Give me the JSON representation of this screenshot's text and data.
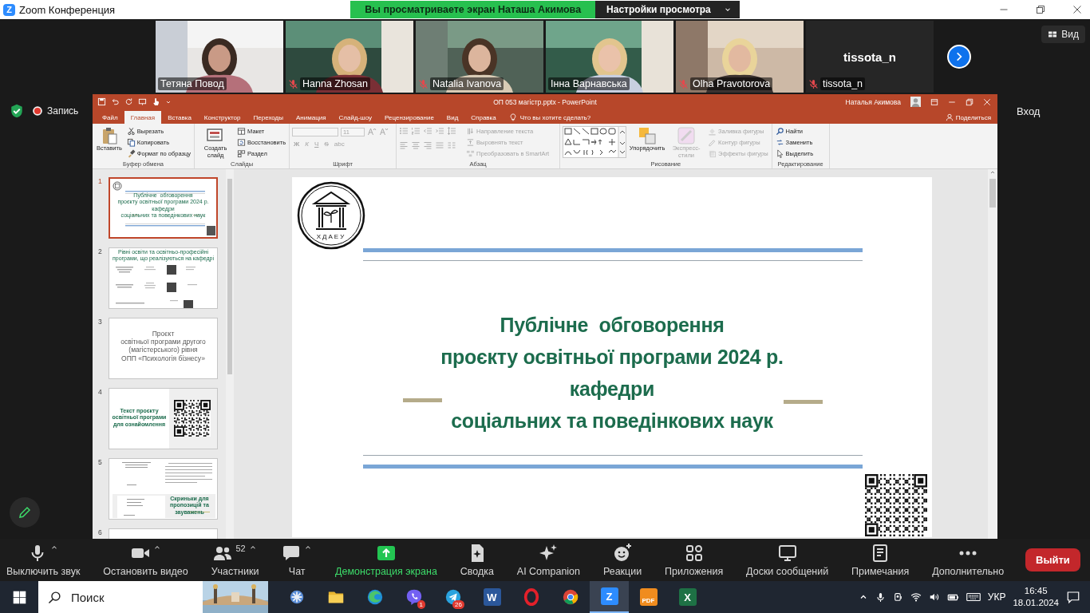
{
  "window": {
    "logo": "Z",
    "title": "Zoom Конференция"
  },
  "share_banner": {
    "text": "Вы просматриваете экран Наташа Акимова",
    "options": "Настройки просмотра"
  },
  "participants": [
    {
      "kind": "video",
      "name": "Тетяна Повод",
      "muted": false,
      "active_speaker": false
    },
    {
      "kind": "video",
      "name": "Hanna Zhosan",
      "muted": true,
      "active_speaker": false
    },
    {
      "kind": "video",
      "name": "Natalia Ivanova",
      "muted": true,
      "active_speaker": false
    },
    {
      "kind": "video",
      "name": "Інна Варнавська",
      "muted": false,
      "active_speaker": true
    },
    {
      "kind": "video",
      "name": "Olha Pravotorova",
      "muted": true,
      "active_speaker": false
    },
    {
      "kind": "no_video",
      "display_name": "tissota_n",
      "name": "tissota_n",
      "muted": true,
      "active_speaker": false
    }
  ],
  "view_button": "Вид",
  "recording": "Запись",
  "sign_in": "Вход",
  "powerpoint": {
    "title": "ОП 053 магістр.pptx  -  PowerPoint",
    "user": "Наталья Акимова",
    "tabs": [
      {
        "label": "Файл",
        "selected": false
      },
      {
        "label": "Главная",
        "selected": true
      },
      {
        "label": "Вставка",
        "selected": false
      },
      {
        "label": "Конструктор",
        "selected": false
      },
      {
        "label": "Переходы",
        "selected": false
      },
      {
        "label": "Анимация",
        "selected": false
      },
      {
        "label": "Слайд-шоу",
        "selected": false
      },
      {
        "label": "Рецензирование",
        "selected": false
      },
      {
        "label": "Вид",
        "selected": false
      },
      {
        "label": "Справка",
        "selected": false
      }
    ],
    "tell_me": "Что вы хотите сделать?",
    "share": "Поделиться",
    "ribbon": [
      {
        "kind": "clipboard",
        "label": "Буфер обмена",
        "items": [
          {
            "kind": "large",
            "label": "Вставить",
            "disabled": false
          },
          {
            "kind": "small",
            "label": "Вырезать",
            "disabled": false
          },
          {
            "kind": "small",
            "label": "Копировать",
            "disabled": false
          },
          {
            "kind": "small",
            "label": "Формат по образцу",
            "disabled": false
          }
        ]
      },
      {
        "kind": "slides",
        "label": "Слайды",
        "items": [
          {
            "kind": "large",
            "label": "Создать слайд",
            "disabled": false
          },
          {
            "kind": "small",
            "label": "Макет",
            "disabled": false
          },
          {
            "kind": "small",
            "label": "Восстановить",
            "disabled": false
          },
          {
            "kind": "small",
            "label": "Раздел",
            "disabled": false
          }
        ]
      },
      {
        "kind": "font",
        "label": "Шрифт",
        "font_size": "11",
        "format_buttons": [
          "Ж",
          "К",
          "Ч",
          "S",
          "abc"
        ],
        "disabled": true
      },
      {
        "kind": "paragraph",
        "label": "Абзац",
        "items": [
          {
            "kind": "small",
            "label": "Направление текста",
            "disabled": true
          },
          {
            "kind": "small",
            "label": "Выровнять текст",
            "disabled": true
          },
          {
            "kind": "small",
            "label": "Преобразовать в SmartArt",
            "disabled": true
          }
        ]
      },
      {
        "kind": "drawing",
        "label": "Рисование",
        "items": [
          {
            "kind": "large",
            "label": "Упорядочить",
            "disabled": false
          },
          {
            "kind": "large",
            "label": "Экспресс-стили",
            "disabled": true
          },
          {
            "kind": "small",
            "label": "Заливка фигуры",
            "disabled": true
          },
          {
            "kind": "small",
            "label": "Контур фигуры",
            "disabled": true
          },
          {
            "kind": "small",
            "label": "Эффекты фигуры",
            "disabled": true
          }
        ]
      },
      {
        "kind": "editing",
        "label": "Редактирование",
        "items": [
          {
            "kind": "small",
            "label": "Найти",
            "disabled": false
          },
          {
            "kind": "small",
            "label": "Заменить",
            "disabled": false
          },
          {
            "kind": "small",
            "label": "Выделить",
            "disabled": false
          }
        ]
      }
    ],
    "slides": [
      {
        "number": "1",
        "selected": true,
        "kind": "title",
        "lines": [
          "Публічне  обговорення",
          "проєкту освітньої програми 2024 р.",
          "кафедри",
          "соціальних та поведінкових наук"
        ]
      },
      {
        "number": "2",
        "selected": false,
        "kind": "levels",
        "lines": [
          "Рівні освіти та освітньо-професійні програми, що реалізуються на кафедрі"
        ]
      },
      {
        "number": "3",
        "selected": false,
        "kind": "text",
        "lines": [
          "Проєкт",
          "освітньої програми другого",
          "(магістерського) рівня",
          "ОПП «Психологія бізнесу»"
        ]
      },
      {
        "number": "4",
        "selected": false,
        "kind": "qr",
        "lines": [
          "Текст проєкту",
          "освітньої програми",
          "для ознайомлення"
        ]
      },
      {
        "number": "5",
        "selected": false,
        "kind": "mailbox",
        "lines": [
          "Скриньки для",
          "пропозицій та",
          "зауважень"
        ]
      },
      {
        "number": "6",
        "selected": false,
        "kind": "blank"
      }
    ],
    "slide": {
      "logo_text": "ХДАЕУ",
      "title_lines": [
        "Публічне  обговорення",
        "проєкту освітньої програми 2024 р.",
        "кафедри",
        "соціальних та поведінкових наук"
      ]
    }
  },
  "toolbar": {
    "items": [
      {
        "label": "Выключить звук",
        "caret": true,
        "active": false
      },
      {
        "label": "Остановить видео",
        "caret": true,
        "active": false
      },
      {
        "label": "Участники",
        "count": "52",
        "caret": true,
        "active": false
      },
      {
        "label": "Чат",
        "caret": true,
        "active": false
      },
      {
        "label": "Демонстрация экрана",
        "caret": false,
        "active": true
      },
      {
        "label": "Сводка",
        "caret": false,
        "active": false
      },
      {
        "label": "AI Companion",
        "caret": false,
        "active": false
      },
      {
        "label": "Реакции",
        "caret": false,
        "active": false
      },
      {
        "label": "Приложения",
        "caret": false,
        "active": false
      },
      {
        "label": "Доски сообщений",
        "caret": false,
        "active": false
      },
      {
        "label": "Примечания",
        "caret": false,
        "active": false
      },
      {
        "label": "Дополнительно",
        "caret": false,
        "active": false
      }
    ],
    "leave": "Выйти"
  },
  "taskbar": {
    "search_placeholder": "Поиск",
    "apps": [
      {
        "active": false
      },
      {
        "active": false
      },
      {
        "active": false
      },
      {
        "active": false,
        "badge": "1"
      },
      {
        "active": false,
        "badge": "26"
      },
      {
        "active": false,
        "glyph": "W"
      },
      {
        "active": false
      },
      {
        "active": false
      },
      {
        "active": true,
        "glyph": "Z"
      },
      {
        "active": false,
        "glyph": "PDF"
      },
      {
        "active": false,
        "glyph": "X"
      }
    ],
    "language": "УКР",
    "time": "16:45",
    "date": "18.01.2024"
  }
}
